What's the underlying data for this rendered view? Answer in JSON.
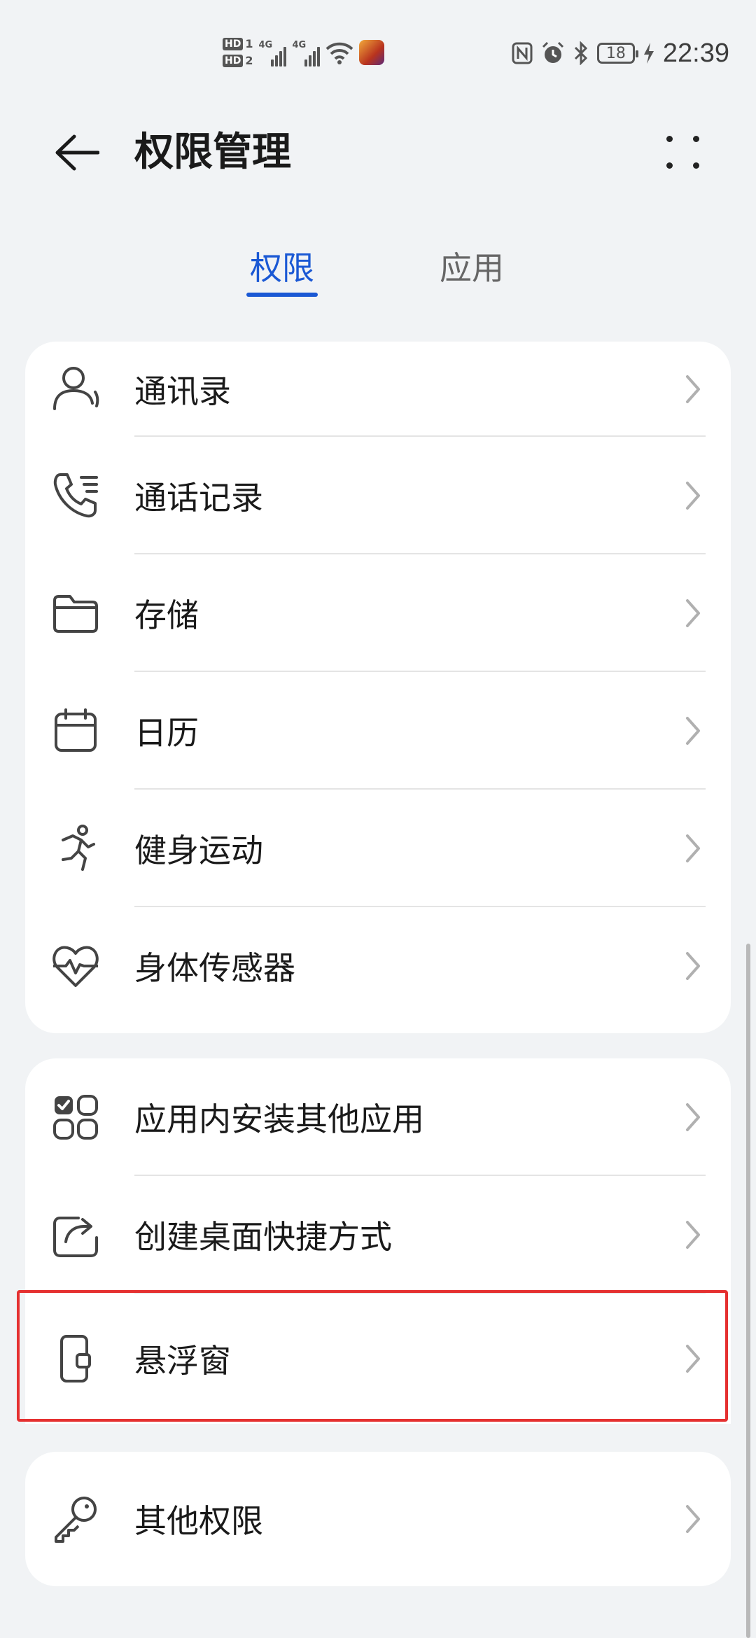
{
  "status_bar": {
    "sim1": "HD",
    "sim1_num": "1",
    "sim2": "HD",
    "sim2_num": "2",
    "net1": "4G",
    "net2": "4G",
    "battery": "18",
    "time": "22:39"
  },
  "header": {
    "title": "权限管理"
  },
  "tabs": [
    {
      "label": "权限",
      "active": true
    },
    {
      "label": "应用",
      "active": false
    }
  ],
  "groups": [
    {
      "items": [
        {
          "label": "通讯录",
          "icon": "contacts-icon"
        },
        {
          "label": "通话记录",
          "icon": "call-log-icon"
        },
        {
          "label": "存储",
          "icon": "folder-icon"
        },
        {
          "label": "日历",
          "icon": "calendar-icon"
        },
        {
          "label": "健身运动",
          "icon": "running-icon"
        },
        {
          "label": "身体传感器",
          "icon": "heart-rate-icon"
        }
      ]
    },
    {
      "items": [
        {
          "label": "应用内安装其他应用",
          "icon": "apps-install-icon"
        },
        {
          "label": "创建桌面快捷方式",
          "icon": "shortcut-icon"
        },
        {
          "label": "悬浮窗",
          "icon": "floating-window-icon",
          "highlighted": true
        }
      ]
    },
    {
      "items": [
        {
          "label": "其他权限",
          "icon": "key-icon"
        }
      ]
    }
  ],
  "colors": {
    "accent": "#1a58d4",
    "highlight_border": "#e53030",
    "background": "#f1f3f5"
  }
}
